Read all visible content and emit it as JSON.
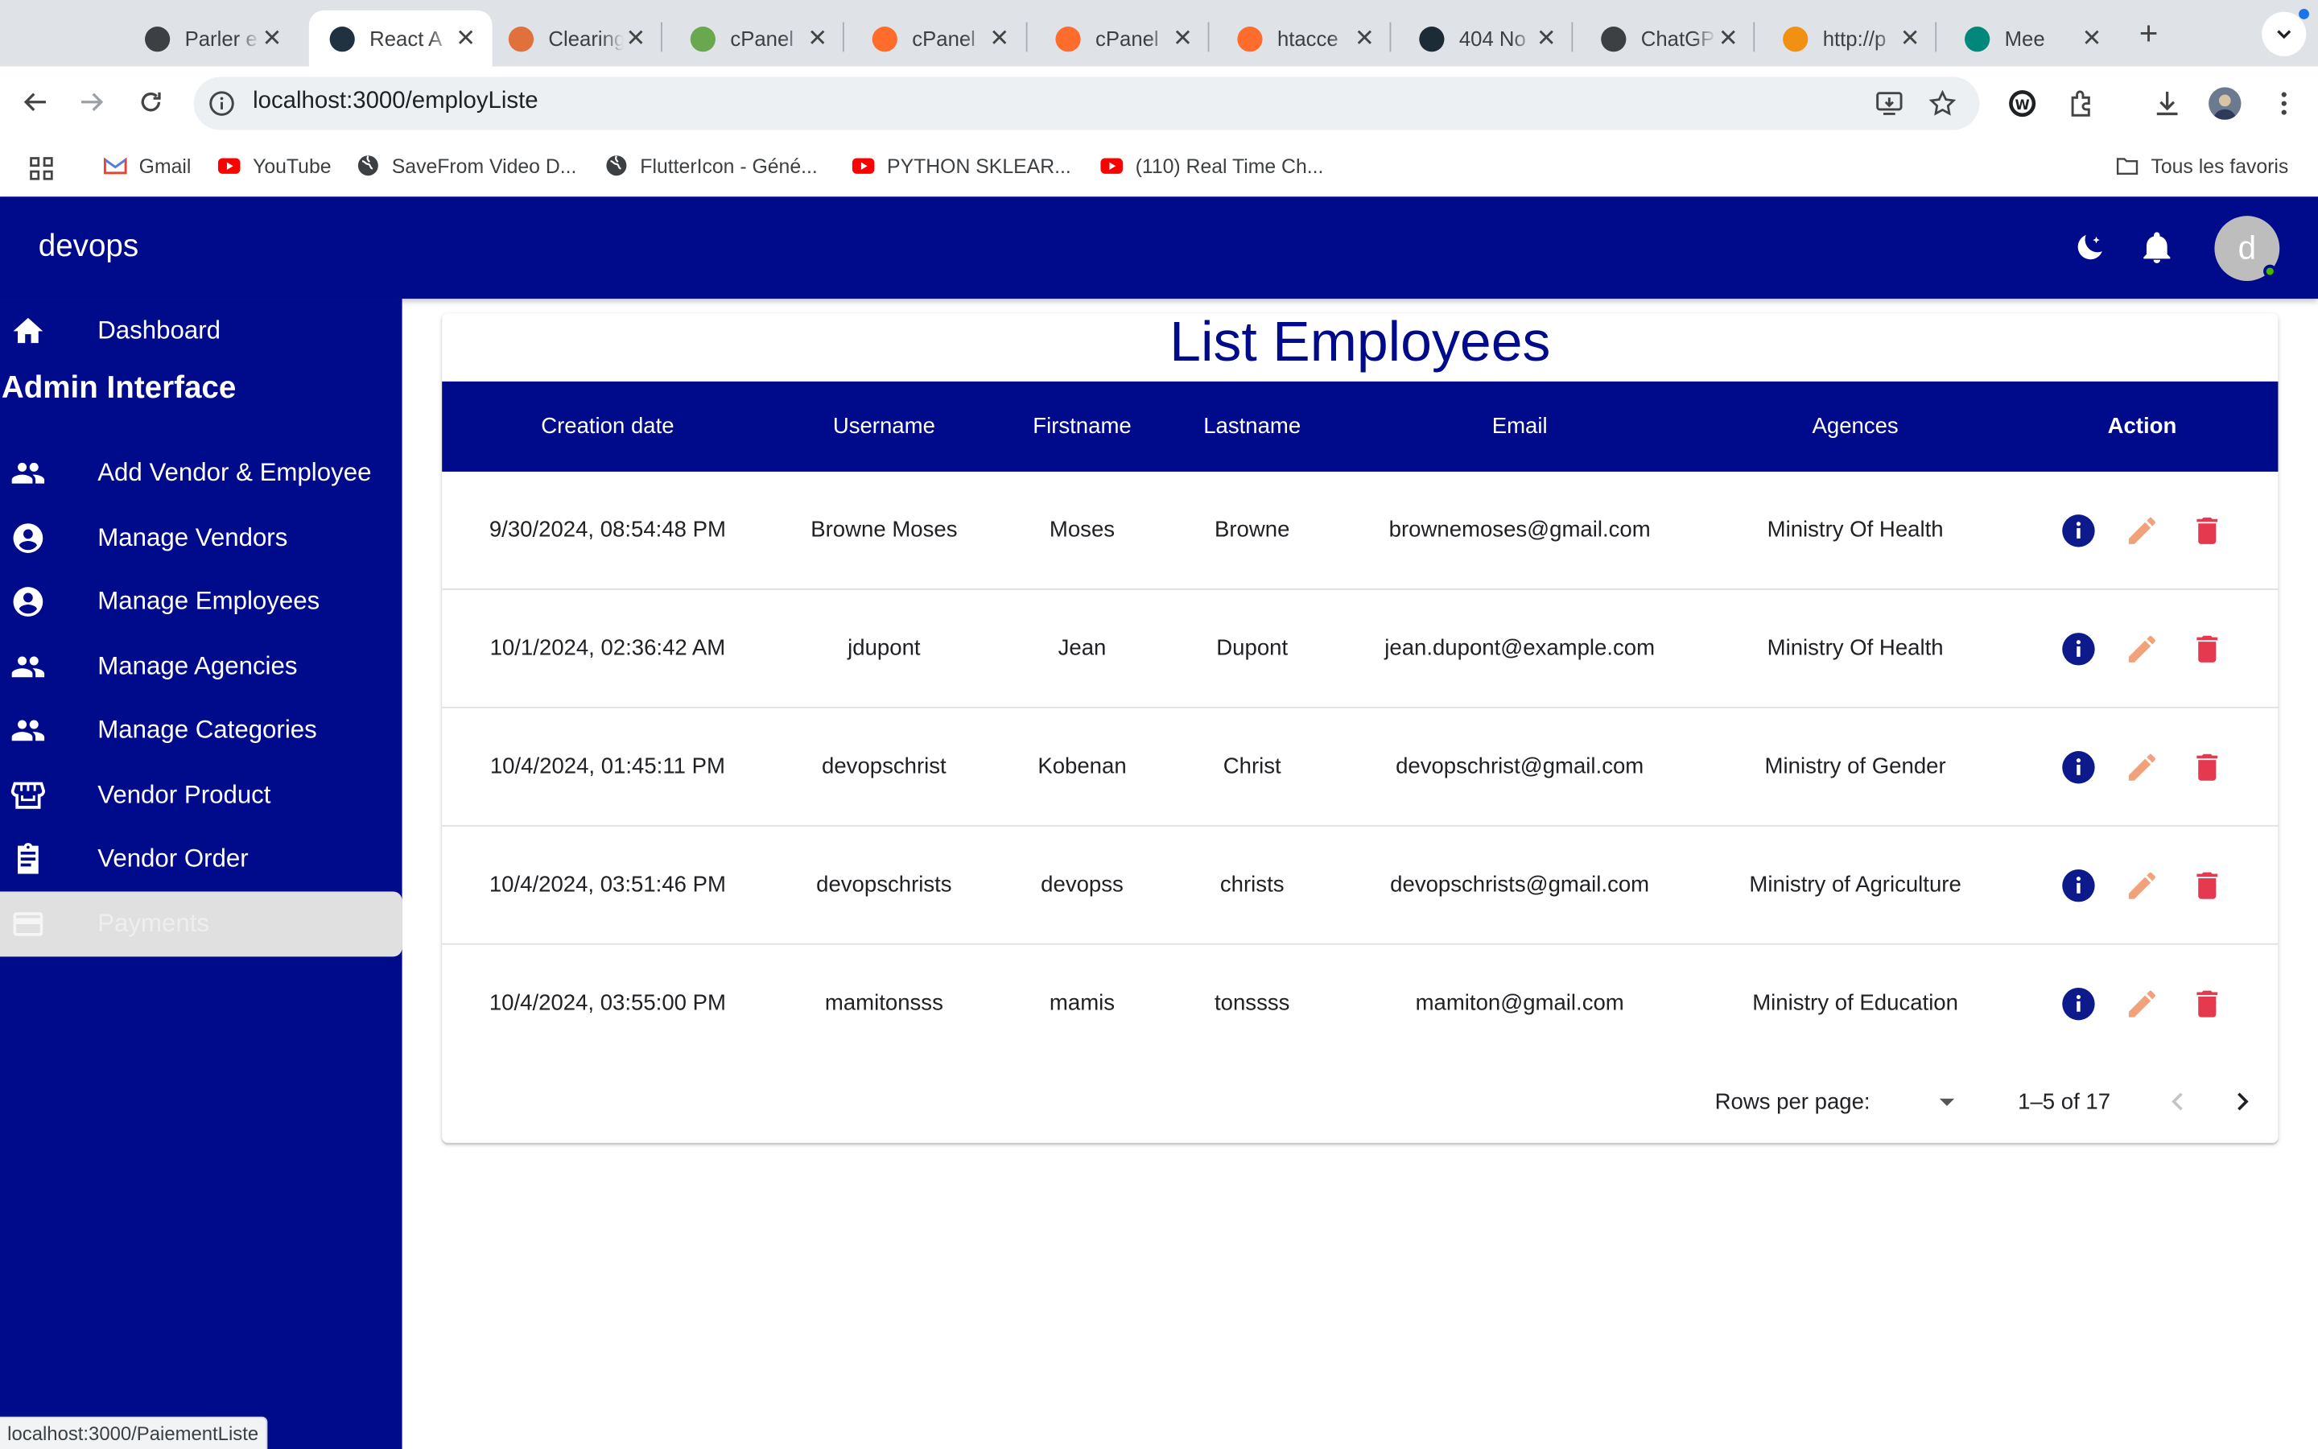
{
  "browser": {
    "tabs": [
      {
        "title": "Parler e",
        "icon": "openai-icon"
      },
      {
        "title": "React A",
        "icon": "react-app-icon"
      },
      {
        "title": "Clearing",
        "icon": "asterisk-icon"
      },
      {
        "title": "cPanel",
        "icon": "cpanel-green-icon"
      },
      {
        "title": "cPanel",
        "icon": "cpanel-icon"
      },
      {
        "title": "cPanel",
        "icon": "cpanel-icon"
      },
      {
        "title": "htacce",
        "icon": "cpanel-icon"
      },
      {
        "title": "404 No",
        "icon": "react-icon"
      },
      {
        "title": "ChatGP",
        "icon": "openai-icon"
      },
      {
        "title": "http://p",
        "icon": "phpmyadmin-icon"
      },
      {
        "title": "Mee",
        "icon": "meet-icon"
      }
    ],
    "url": "localhost:3000/employListe",
    "bookmarks": [
      {
        "label": "Gmail",
        "icon": "gmail-icon"
      },
      {
        "label": "YouTube",
        "icon": "youtube-icon"
      },
      {
        "label": "SaveFrom Video D...",
        "icon": "globe-icon"
      },
      {
        "label": "FlutterIcon - Géné...",
        "icon": "globe-icon"
      },
      {
        "label": "PYTHON SKLEAR...",
        "icon": "youtube-icon"
      },
      {
        "label": "(110) Real Time Ch...",
        "icon": "youtube-icon"
      }
    ],
    "all_bookmarks": "Tous les favoris",
    "status_url": "localhost:3000/PaiementListe"
  },
  "app": {
    "brand": "devops",
    "avatar_letter": "d",
    "admin_title": "Admin Interface",
    "nav": {
      "dashboard": "Dashboard",
      "items": [
        {
          "label": "Add Vendor & Employee",
          "icon": "people-icon"
        },
        {
          "label": "Manage Vendors",
          "icon": "account-circle-icon"
        },
        {
          "label": "Manage Employees",
          "icon": "account-circle-icon"
        },
        {
          "label": "Manage Agencies",
          "icon": "people-icon"
        },
        {
          "label": "Manage Categories",
          "icon": "people-icon"
        },
        {
          "label": "Vendor Product",
          "icon": "store-icon"
        },
        {
          "label": "Vendor Order",
          "icon": "assignment-icon"
        },
        {
          "label": "Payments",
          "icon": "credit-card-icon"
        }
      ]
    }
  },
  "table": {
    "title": "List Employees",
    "headers": {
      "creation_date": "Creation date",
      "username": "Username",
      "firstname": "Firstname",
      "lastname": "Lastname",
      "email": "Email",
      "agencies": "Agences",
      "action": "Action"
    },
    "rows": [
      {
        "date": "9/30/2024, 08:54:48 PM",
        "username": "Browne Moses",
        "firstname": "Moses",
        "lastname": "Browne",
        "email": "brownemoses@gmail.com",
        "agency": "Ministry Of Health"
      },
      {
        "date": "10/1/2024, 02:36:42 AM",
        "username": "jdupont",
        "firstname": "Jean",
        "lastname": "Dupont",
        "email": "jean.dupont@example.com",
        "agency": "Ministry Of Health"
      },
      {
        "date": "10/4/2024, 01:45:11 PM",
        "username": "devopschrist",
        "firstname": "Kobenan",
        "lastname": "Christ",
        "email": "devopschrist@gmail.com",
        "agency": "Ministry of Gender"
      },
      {
        "date": "10/4/2024, 03:51:46 PM",
        "username": "devopschrists",
        "firstname": "devopss",
        "lastname": "christs",
        "email": "devopschrists@gmail.com",
        "agency": "Ministry of Agriculture"
      },
      {
        "date": "10/4/2024, 03:55:00 PM",
        "username": "mamitonsss",
        "firstname": "mamis",
        "lastname": "tonssss",
        "email": "mamiton@gmail.com",
        "agency": "Ministry of Education"
      }
    ],
    "pagination": {
      "rows_per_page_label": "Rows per page:",
      "range": "1–5 of 17"
    }
  },
  "colors": {
    "primary": "#000b8c",
    "info": "#0d1a8c",
    "edit": "#f2a27a",
    "delete": "#e53950"
  }
}
